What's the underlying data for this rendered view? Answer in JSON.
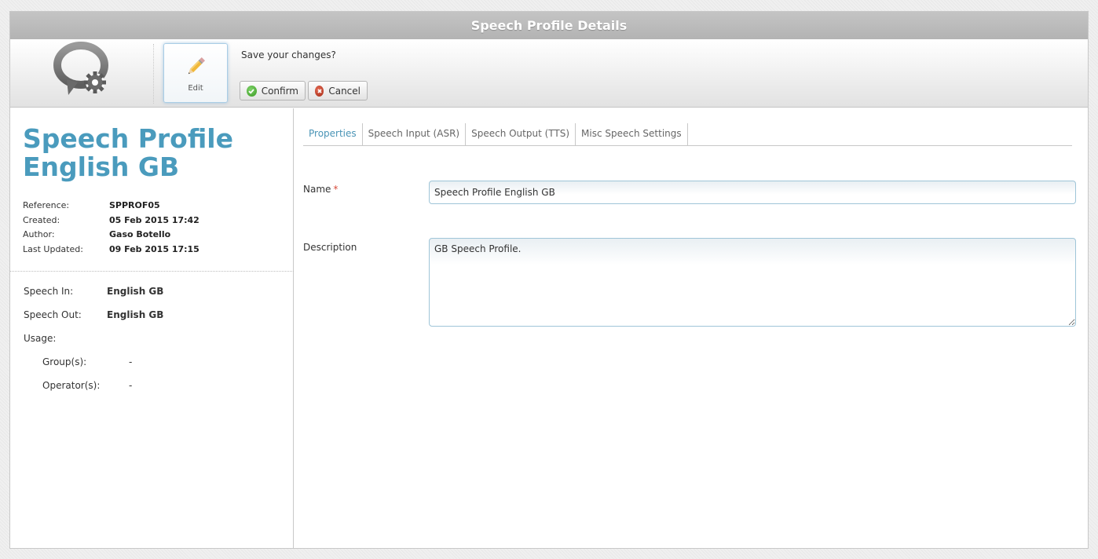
{
  "window": {
    "title": "Speech Profile Details"
  },
  "toolbar": {
    "edit_label": "Edit",
    "save_prompt": "Save your changes?",
    "confirm_label": "Confirm",
    "cancel_label": "Cancel"
  },
  "profile": {
    "title": "Speech Profile English GB",
    "meta": [
      {
        "label": "Reference:",
        "value": "SPPROF05"
      },
      {
        "label": "Created:",
        "value": "05 Feb 2015 17:42"
      },
      {
        "label": "Author:",
        "value": "Gaso Botello"
      },
      {
        "label": "Last Updated:",
        "value": "09 Feb 2015 17:15"
      }
    ],
    "speech_in_label": "Speech In:",
    "speech_in_value": "English GB",
    "speech_out_label": "Speech Out:",
    "speech_out_value": "English GB",
    "usage_label": "Usage:",
    "groups_label": "Group(s):",
    "groups_value": "-",
    "operators_label": "Operator(s):",
    "operators_value": "-"
  },
  "tabs": [
    {
      "label": "Properties",
      "active": true
    },
    {
      "label": "Speech Input (ASR)",
      "active": false
    },
    {
      "label": "Speech Output (TTS)",
      "active": false
    },
    {
      "label": "Misc Speech Settings",
      "active": false
    }
  ],
  "form": {
    "name_label": "Name",
    "required_mark": "*",
    "name_value": "Speech Profile English GB",
    "description_label": "Description",
    "description_value": "GB Speech Profile."
  },
  "icons": {
    "logo": "speech-bubble-gear-icon",
    "edit": "pencil-icon",
    "confirm": "check-circle-icon",
    "cancel": "x-circle-icon"
  },
  "colors": {
    "accent": "#4a9bbd",
    "active_tab": "#4a94b6",
    "required": "#d84b3b",
    "titlebar": "#b8b8b8"
  }
}
